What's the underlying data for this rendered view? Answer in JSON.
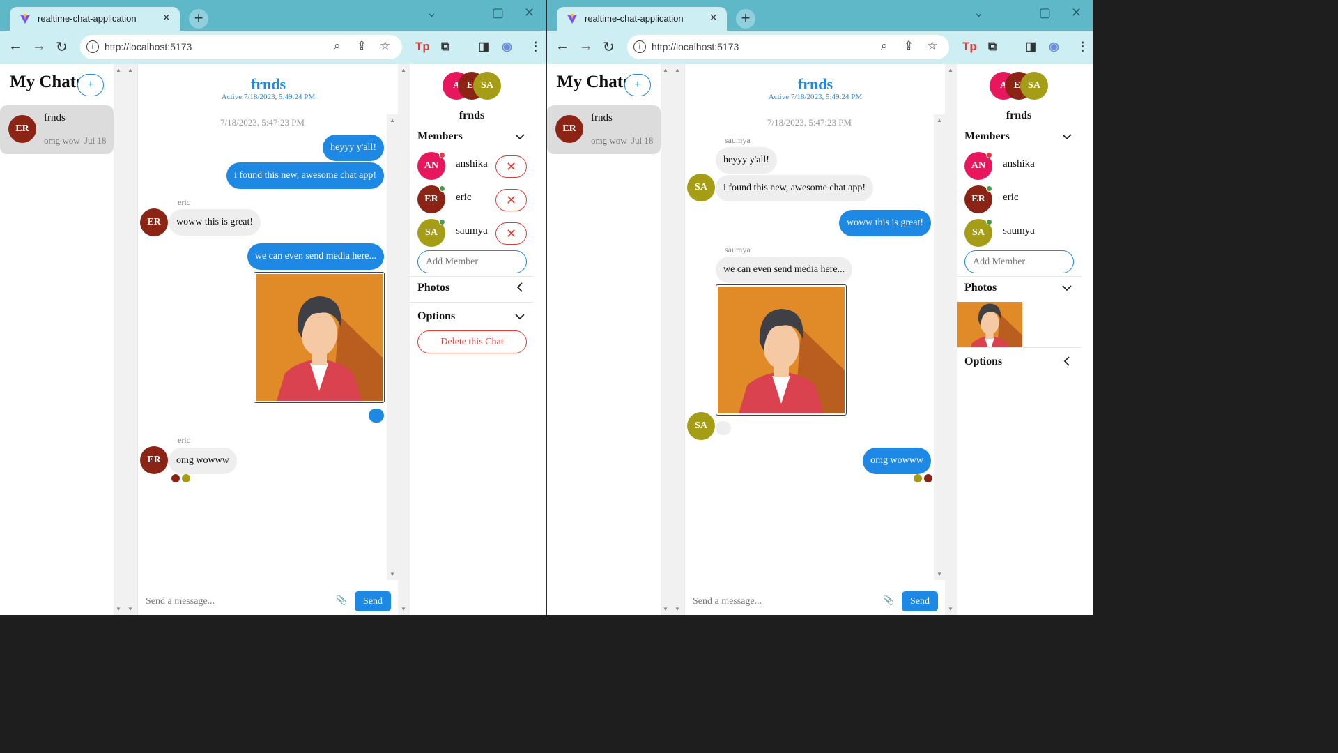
{
  "colors": {
    "accent": "#1e88e5",
    "danger": "#e53935",
    "an": "#e8175d",
    "er": "#8b2414",
    "sa": "#a59d15",
    "online": "#43a047",
    "offline": "#e53935",
    "titlebar": "#5fb8c8",
    "toolbar": "#cdeef3"
  },
  "browser": {
    "tab_title": "realtime-chat-application",
    "url": "http://localhost:5173",
    "icons": [
      "vite-logo-icon",
      "close-icon",
      "new-tab-icon",
      "minimize-icon",
      "maximize-icon",
      "window-close-icon",
      "back-icon",
      "forward-icon",
      "reload-icon",
      "site-info-icon",
      "zoom-icon",
      "share-icon",
      "bookmark-star-icon",
      "tp-extension-icon",
      "extensions-puzzle-icon",
      "side-panel-icon",
      "profile-avatar-icon",
      "menu-kebab-icon"
    ]
  },
  "sidebar": {
    "title": "My Chats",
    "add_label": "+",
    "chats": [
      {
        "name": "frnds",
        "avatar": "ER",
        "preview": "omg wow",
        "date": "Jul 18"
      }
    ]
  },
  "chat": {
    "name": "frnds",
    "active": "Active 7/18/2023, 5:49:24 PM",
    "date_divider": "7/18/2023, 5:47:23 PM",
    "input_placeholder": "Send a message...",
    "send_label": "Send",
    "attach_icon": "paperclip-icon"
  },
  "messages": {
    "m1": "heyyy y'all!",
    "m2": "i found this new, awesome chat app!",
    "m3": "woww this is great!",
    "m4": "we can even send media here...",
    "m5": "omg wowww",
    "sender_eric": "eric",
    "sender_saumya": "saumya"
  },
  "avatars": {
    "an": "AN",
    "er": "ER",
    "sa": "SA",
    "an_short": "A",
    "er_short": "EI"
  },
  "details": {
    "name": "frnds",
    "members_label": "Members",
    "photos_label": "Photos",
    "options_label": "Options",
    "add_member_placeholder": "Add Member",
    "delete_label": "Delete this Chat",
    "remove_label": "✕",
    "members": [
      {
        "initials": "AN",
        "name": "anshika",
        "status": "offline"
      },
      {
        "initials": "ER",
        "name": "eric",
        "status": "online"
      },
      {
        "initials": "SA",
        "name": "saumya",
        "status": "online"
      }
    ]
  }
}
